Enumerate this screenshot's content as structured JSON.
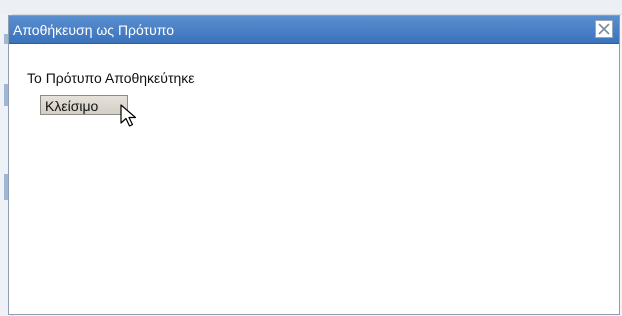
{
  "dialog": {
    "title": "Αποθήκευση ως Πρότυπο",
    "close_icon": "close-icon",
    "message": "Το Πρότυπο Αποθηκεύτηκε",
    "close_button_label": "Κλείσιμο"
  },
  "colors": {
    "titlebar": "#4a80c6",
    "title_text": "#ffffff",
    "button_bg": "#ddd8d0"
  },
  "cursor": "arrow-cursor-icon"
}
